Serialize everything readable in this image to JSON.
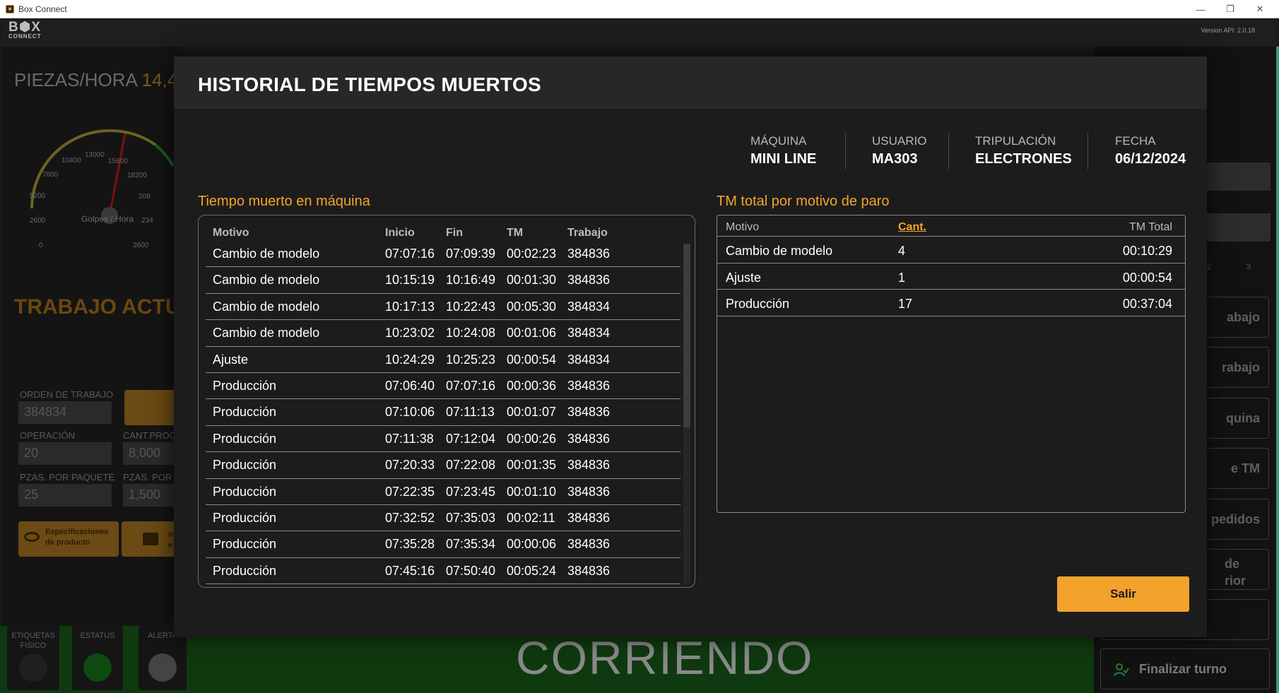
{
  "window": {
    "title": "Box Connect",
    "controls": [
      "—",
      "❐",
      "✕"
    ]
  },
  "header": {
    "logo_main": "B⬢X",
    "logo_sub": "CONNECT",
    "api_version": "Version API: 2.0.18"
  },
  "background": {
    "pph_label": "PIEZAS/HORA",
    "pph_value": "14,4",
    "gauge": {
      "label": "Golpes / Hora",
      "ticks": [
        "0",
        "2600",
        "5200",
        "7800",
        "10400",
        "13000",
        "15600",
        "18200",
        "208",
        "234",
        "2600"
      ]
    },
    "trabajo_title": "TRABAJO ACTU",
    "fields": {
      "orden_label": "ORDEN DE TRABAJO",
      "orden_value": "384834",
      "operacion_label": "OPERACIÓN",
      "operacion_value": "20",
      "cant_label": "CANT.PROG",
      "cant_value": "8,000",
      "pzas_paquete_label": "PZAS. POR PAQUETE",
      "pzas_paquete_value": "25",
      "pzas_por_label": "PZAS. POR",
      "pzas_por_value": "1,500"
    },
    "spec_button": "Especificaciones de producto",
    "print_button_partial": "In e",
    "bottom_tiles": {
      "etiquetas": "ETIQUETAS FISICO",
      "estatus": "ESTATUS",
      "alerta": "ALERTA"
    },
    "status_text": "CORRIENDO",
    "right_nav": [
      "abajo",
      "rabajo",
      "quina",
      "e TM",
      "pedidos",
      "de rior"
    ],
    "right_small": [
      "2",
      "3"
    ],
    "finalizar": "Finalizar turno"
  },
  "modal": {
    "title": "HISTORIAL DE TIEMPOS MUERTOS",
    "info": {
      "maquina_label": "MÁQUINA",
      "maquina_value": "MINI LINE",
      "usuario_label": "USUARIO",
      "usuario_value": "MA303",
      "tripulacion_label": "TRIPULACIÓN",
      "tripulacion_value": "ELECTRONES",
      "fecha_label": "FECHA",
      "fecha_value": "06/12/2024"
    },
    "left_section_title": "Tiempo muerto en máquina",
    "left_columns": [
      "Motivo",
      "Inicio",
      "Fin",
      "TM",
      "Trabajo"
    ],
    "left_rows": [
      [
        "Cambio de modelo",
        "07:07:16",
        "07:09:39",
        "00:02:23",
        "384836"
      ],
      [
        "Cambio de modelo",
        "10:15:19",
        "10:16:49",
        "00:01:30",
        "384836"
      ],
      [
        "Cambio de modelo",
        "10:17:13",
        "10:22:43",
        "00:05:30",
        "384834"
      ],
      [
        "Cambio de modelo",
        "10:23:02",
        "10:24:08",
        "00:01:06",
        "384834"
      ],
      [
        "Ajuste",
        "10:24:29",
        "10:25:23",
        "00:00:54",
        "384834"
      ],
      [
        "Producción",
        "07:06:40",
        "07:07:16",
        "00:00:36",
        "384836"
      ],
      [
        "Producción",
        "07:10:06",
        "07:11:13",
        "00:01:07",
        "384836"
      ],
      [
        "Producción",
        "07:11:38",
        "07:12:04",
        "00:00:26",
        "384836"
      ],
      [
        "Producción",
        "07:20:33",
        "07:22:08",
        "00:01:35",
        "384836"
      ],
      [
        "Producción",
        "07:22:35",
        "07:23:45",
        "00:01:10",
        "384836"
      ],
      [
        "Producción",
        "07:32:52",
        "07:35:03",
        "00:02:11",
        "384836"
      ],
      [
        "Producción",
        "07:35:28",
        "07:35:34",
        "00:00:06",
        "384836"
      ],
      [
        "Producción",
        "07:45:16",
        "07:50:40",
        "00:05:24",
        "384836"
      ]
    ],
    "right_section_title": "TM total por motivo de paro",
    "right_columns": [
      "Motivo",
      "Cant.",
      "TM Total"
    ],
    "right_rows": [
      [
        "Cambio de modelo",
        "4",
        "00:10:29"
      ],
      [
        "Ajuste",
        "1",
        "00:00:54"
      ],
      [
        "Producción",
        "17",
        "00:37:04"
      ]
    ],
    "exit_button": "Salir"
  }
}
